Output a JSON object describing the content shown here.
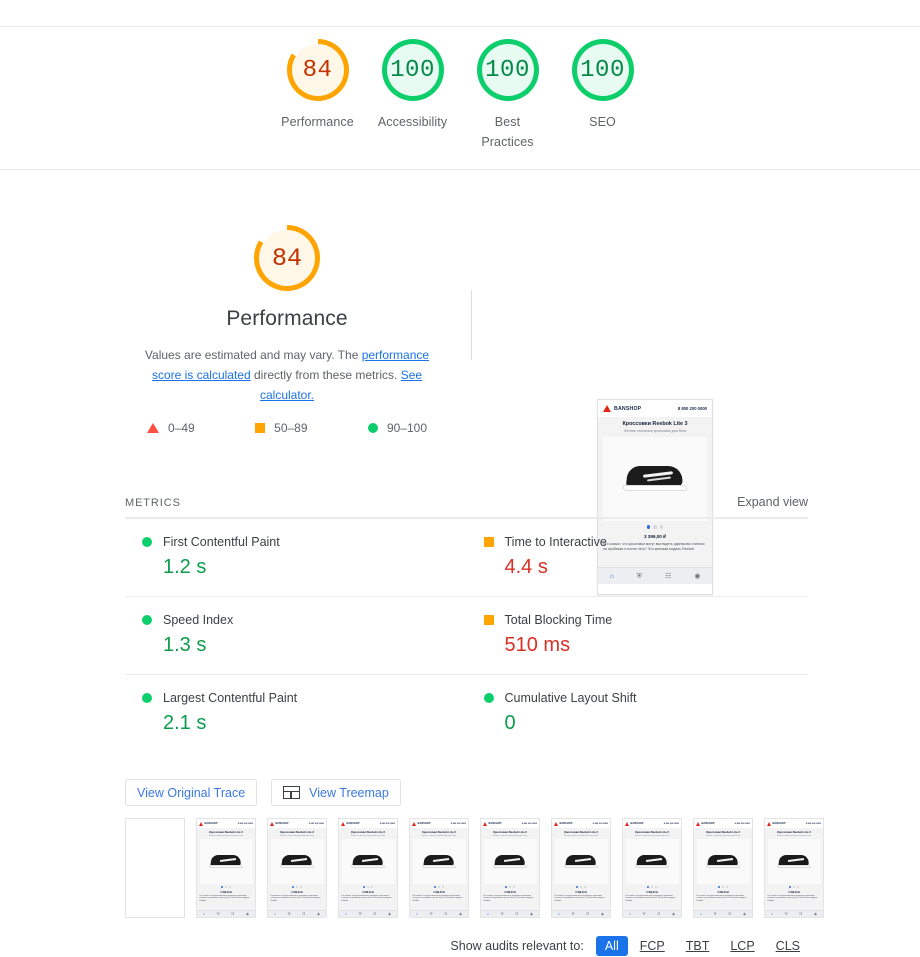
{
  "scores_header": {
    "items": [
      {
        "score": "84",
        "label": "Performance",
        "state": "orange"
      },
      {
        "score": "100",
        "label": "Accessibility",
        "state": "green"
      },
      {
        "score": "100",
        "label": "Best\nPractices",
        "state": "green"
      },
      {
        "score": "100",
        "label": "SEO",
        "state": "green"
      }
    ]
  },
  "hero": {
    "score": "84",
    "title": "Performance",
    "desc_part1": "Values are estimated and may vary. The ",
    "link1": "performance score is calculated",
    "desc_part2": " directly from these metrics. ",
    "link2": "See calculator.",
    "legend": [
      {
        "icon": "triangle-icon",
        "range": "0–49"
      },
      {
        "icon": "square-icon",
        "range": "50–89"
      },
      {
        "icon": "circle-icon",
        "range": "90–100"
      }
    ]
  },
  "preview": {
    "brand": "BANSHOP",
    "phone": "8 800 200 0000",
    "product_title": "Кроссовки Reebok Lite 3",
    "product_subtitle": "Летние стильные кроссовки для бега",
    "price": "3 399,00 ₽",
    "body_text": "Кто сказал, что кроссовки могут выглядеть одинаково стильно на пробежке и после него? Это женская модель Reebok",
    "nav_icons": [
      "home-icon",
      "cart-icon",
      "chat-icon",
      "help-icon"
    ]
  },
  "metrics": {
    "title": "METRICS",
    "expand_view": "Expand view",
    "items": [
      {
        "name": "First Contentful Paint",
        "value": "1.2 s",
        "state": "green",
        "icon": "circle-icon"
      },
      {
        "name": "Time to Interactive",
        "value": "4.4 s",
        "state": "orange",
        "icon": "square-icon"
      },
      {
        "name": "Speed Index",
        "value": "1.3 s",
        "state": "green",
        "icon": "circle-icon"
      },
      {
        "name": "Total Blocking Time",
        "value": "510 ms",
        "state": "orange",
        "icon": "square-icon"
      },
      {
        "name": "Largest Contentful Paint",
        "value": "2.1 s",
        "state": "green",
        "icon": "circle-icon"
      },
      {
        "name": "Cumulative Layout Shift",
        "value": "0",
        "state": "green",
        "icon": "circle-icon"
      }
    ]
  },
  "buttons": {
    "view_original_trace": "View Original Trace",
    "view_treemap": "View Treemap"
  },
  "filmstrip": {
    "frames": [
      "blank",
      "shot",
      "shot",
      "shot",
      "shot",
      "shot",
      "shot",
      "shot",
      "shot",
      "shot"
    ]
  },
  "audits_filter": {
    "label": "Show audits relevant to:",
    "chips": [
      {
        "label": "All",
        "active": true
      },
      {
        "label": "FCP",
        "active": false
      },
      {
        "label": "TBT",
        "active": false
      },
      {
        "label": "LCP",
        "active": false
      },
      {
        "label": "CLS",
        "active": false
      }
    ]
  },
  "colors": {
    "pass": "#0cce6b",
    "average": "#ffa400",
    "fail": "#ff4e42",
    "link": "#1a73e8"
  }
}
